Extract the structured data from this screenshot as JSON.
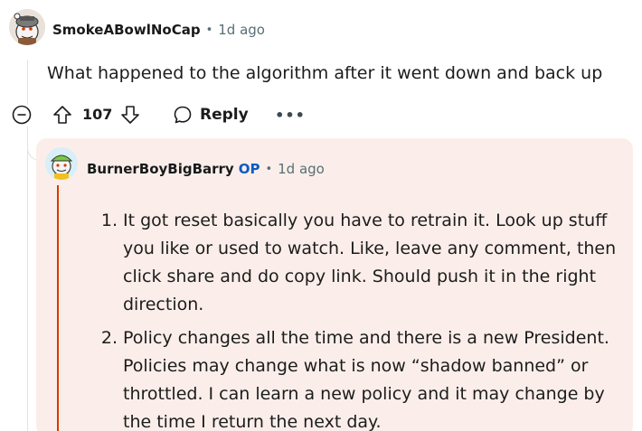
{
  "comment": {
    "username": "SmokeABowlNoCap",
    "separator": "•",
    "time": "1d ago",
    "body": "What happened to the algorithm after it went down and back up",
    "icons": {
      "avatar": "snoo-avatar-icon",
      "collapse": "minus-circle-icon",
      "upvote": "arrow-up-icon",
      "downvote": "arrow-down-icon",
      "reply": "speech-bubble-icon",
      "more": "ellipsis-icon"
    },
    "score": "107",
    "reply_label": "Reply",
    "more_label": "•••"
  },
  "reply": {
    "username": "BurnerBoyBigBarry",
    "op_badge": "OP",
    "separator": "•",
    "time": "1d ago",
    "items": [
      {
        "number": "1.",
        "text": "It got reset basically you have to retrain it. Look up stuff you like or used to watch. Like, leave any comment, then click share and do copy link. Should push it in the right direction."
      },
      {
        "number": "2.",
        "text": "Policy changes all the time and there is a new President. Policies may change what is now “shadow banned” or throttled. I can learn a new policy and it may change by the time I return the next day."
      }
    ]
  },
  "colors": {
    "reply_background": "#fbeeea",
    "op_accent": "#0a5cc2",
    "highlight_rule": "#d93900",
    "muted_text": "#576f76"
  }
}
